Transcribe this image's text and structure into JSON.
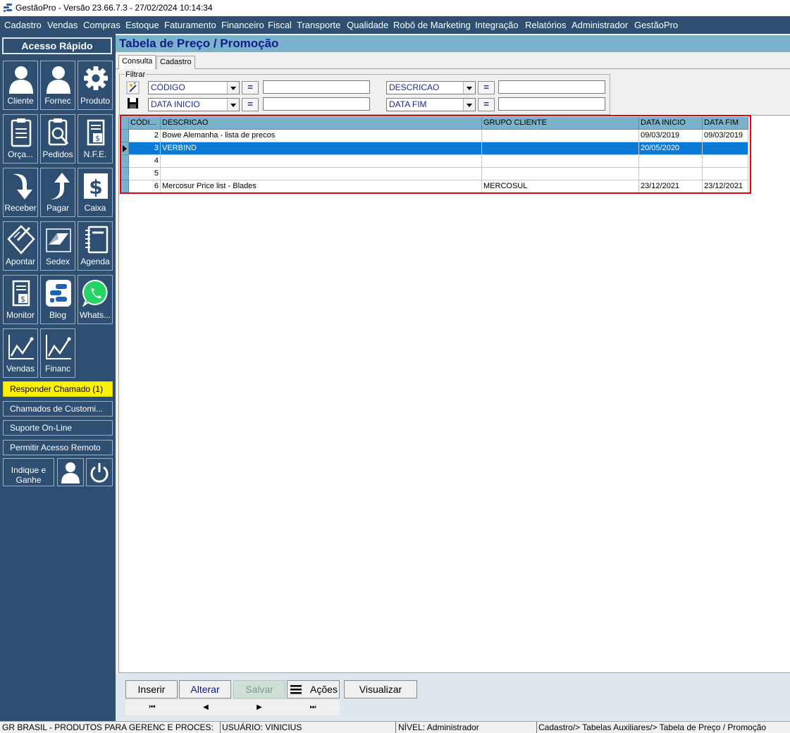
{
  "window": {
    "title": "GestãoPro - Versão 23.66.7.3 - 27/02/2024 10:14:34"
  },
  "menu": [
    "Cadastro",
    "Vendas",
    "Compras",
    "Estoque",
    "Faturamento",
    "Financeiro",
    "Fiscal",
    "Transporte",
    "Qualidade",
    "Robô de Marketing",
    "Integração",
    "Relatórios",
    "Administrador",
    "GestãoPro"
  ],
  "sidebar": {
    "header": "Acesso Rápido",
    "buttons": [
      {
        "label": "Cliente",
        "icon": "person-icon"
      },
      {
        "label": "Fornec",
        "icon": "person-icon"
      },
      {
        "label": "Produto",
        "icon": "gear-icon"
      },
      {
        "label": "Orça...",
        "icon": "clipboard-icon"
      },
      {
        "label": "Pedidos",
        "icon": "clipboard-search-icon"
      },
      {
        "label": "N.F.E.",
        "icon": "invoice-icon"
      },
      {
        "label": "Receber",
        "icon": "arrow-down-icon"
      },
      {
        "label": "Pagar",
        "icon": "arrow-up-icon"
      },
      {
        "label": "Caixa",
        "icon": "dollar-icon"
      },
      {
        "label": "Apontar",
        "icon": "notepad-pen-icon"
      },
      {
        "label": "Sedex",
        "icon": "sedex-icon"
      },
      {
        "label": "Agenda",
        "icon": "notebook-icon"
      },
      {
        "label": "Monitor",
        "icon": "invoice-icon"
      },
      {
        "label": "Blog",
        "icon": "blog-logo-icon"
      },
      {
        "label": "Whats...",
        "icon": "whatsapp-icon"
      },
      {
        "label": "Vendas",
        "icon": "line-chart-icon"
      },
      {
        "label": "Financ",
        "icon": "line-chart-icon"
      }
    ],
    "links": [
      "Responder Chamado (1)",
      "Chamados de Customi...",
      "Suporte On-Line",
      "Permitir Acesso Remoto"
    ],
    "indique": "Indique e Ganhe"
  },
  "page": {
    "title": "Tabela de Preço / Promoção"
  },
  "tabs": [
    "Consulta",
    "Cadastro"
  ],
  "filter": {
    "legend": "Filtrar",
    "row1": {
      "field1": "CÓDIGO",
      "op1": "=",
      "value1": "",
      "field2": "DESCRICAO",
      "op2": "=",
      "value2": ""
    },
    "row2": {
      "field1": "DATA INICIO",
      "op1": "=",
      "value1": "",
      "field2": "DATA FIM",
      "op2": "=",
      "value2": ""
    }
  },
  "grid": {
    "headers": [
      "CÓDI...",
      "DESCRICAO",
      "GRUPO CLIENTE",
      "DATA INICIO",
      "DATA FIM"
    ],
    "rows": [
      [
        "2",
        "Bowe Alemanha - lista de precos",
        "",
        "09/03/2019",
        "09/03/2019"
      ],
      [
        "3",
        "VERBIND",
        "",
        "20/05/2020",
        ""
      ],
      [
        "4",
        "",
        "",
        "",
        ""
      ],
      [
        "5",
        "",
        "",
        "",
        ""
      ],
      [
        "6",
        "Mercosur Price list - Blades",
        "MERCOSUL",
        "23/12/2021",
        "23/12/2021"
      ]
    ],
    "selected_row": 1
  },
  "actions": {
    "inserir": "Inserir",
    "alterar": "Alterar",
    "salvar": "Salvar",
    "acoes": "Ações",
    "visualizar": "Visualizar"
  },
  "nav": {
    "first": "⏮",
    "prev": "◀",
    "next": "▶",
    "last": "⏭"
  },
  "status": {
    "company": "GR BRASIL - PRODUTOS PARA GERENC E PROCES:",
    "user": "USUÁRIO: VINICIUS",
    "level": "NÍVEL: Administrador",
    "path": "Cadastro/> Tabelas Auxiliares/> Tabela de Preço / Promoção"
  }
}
